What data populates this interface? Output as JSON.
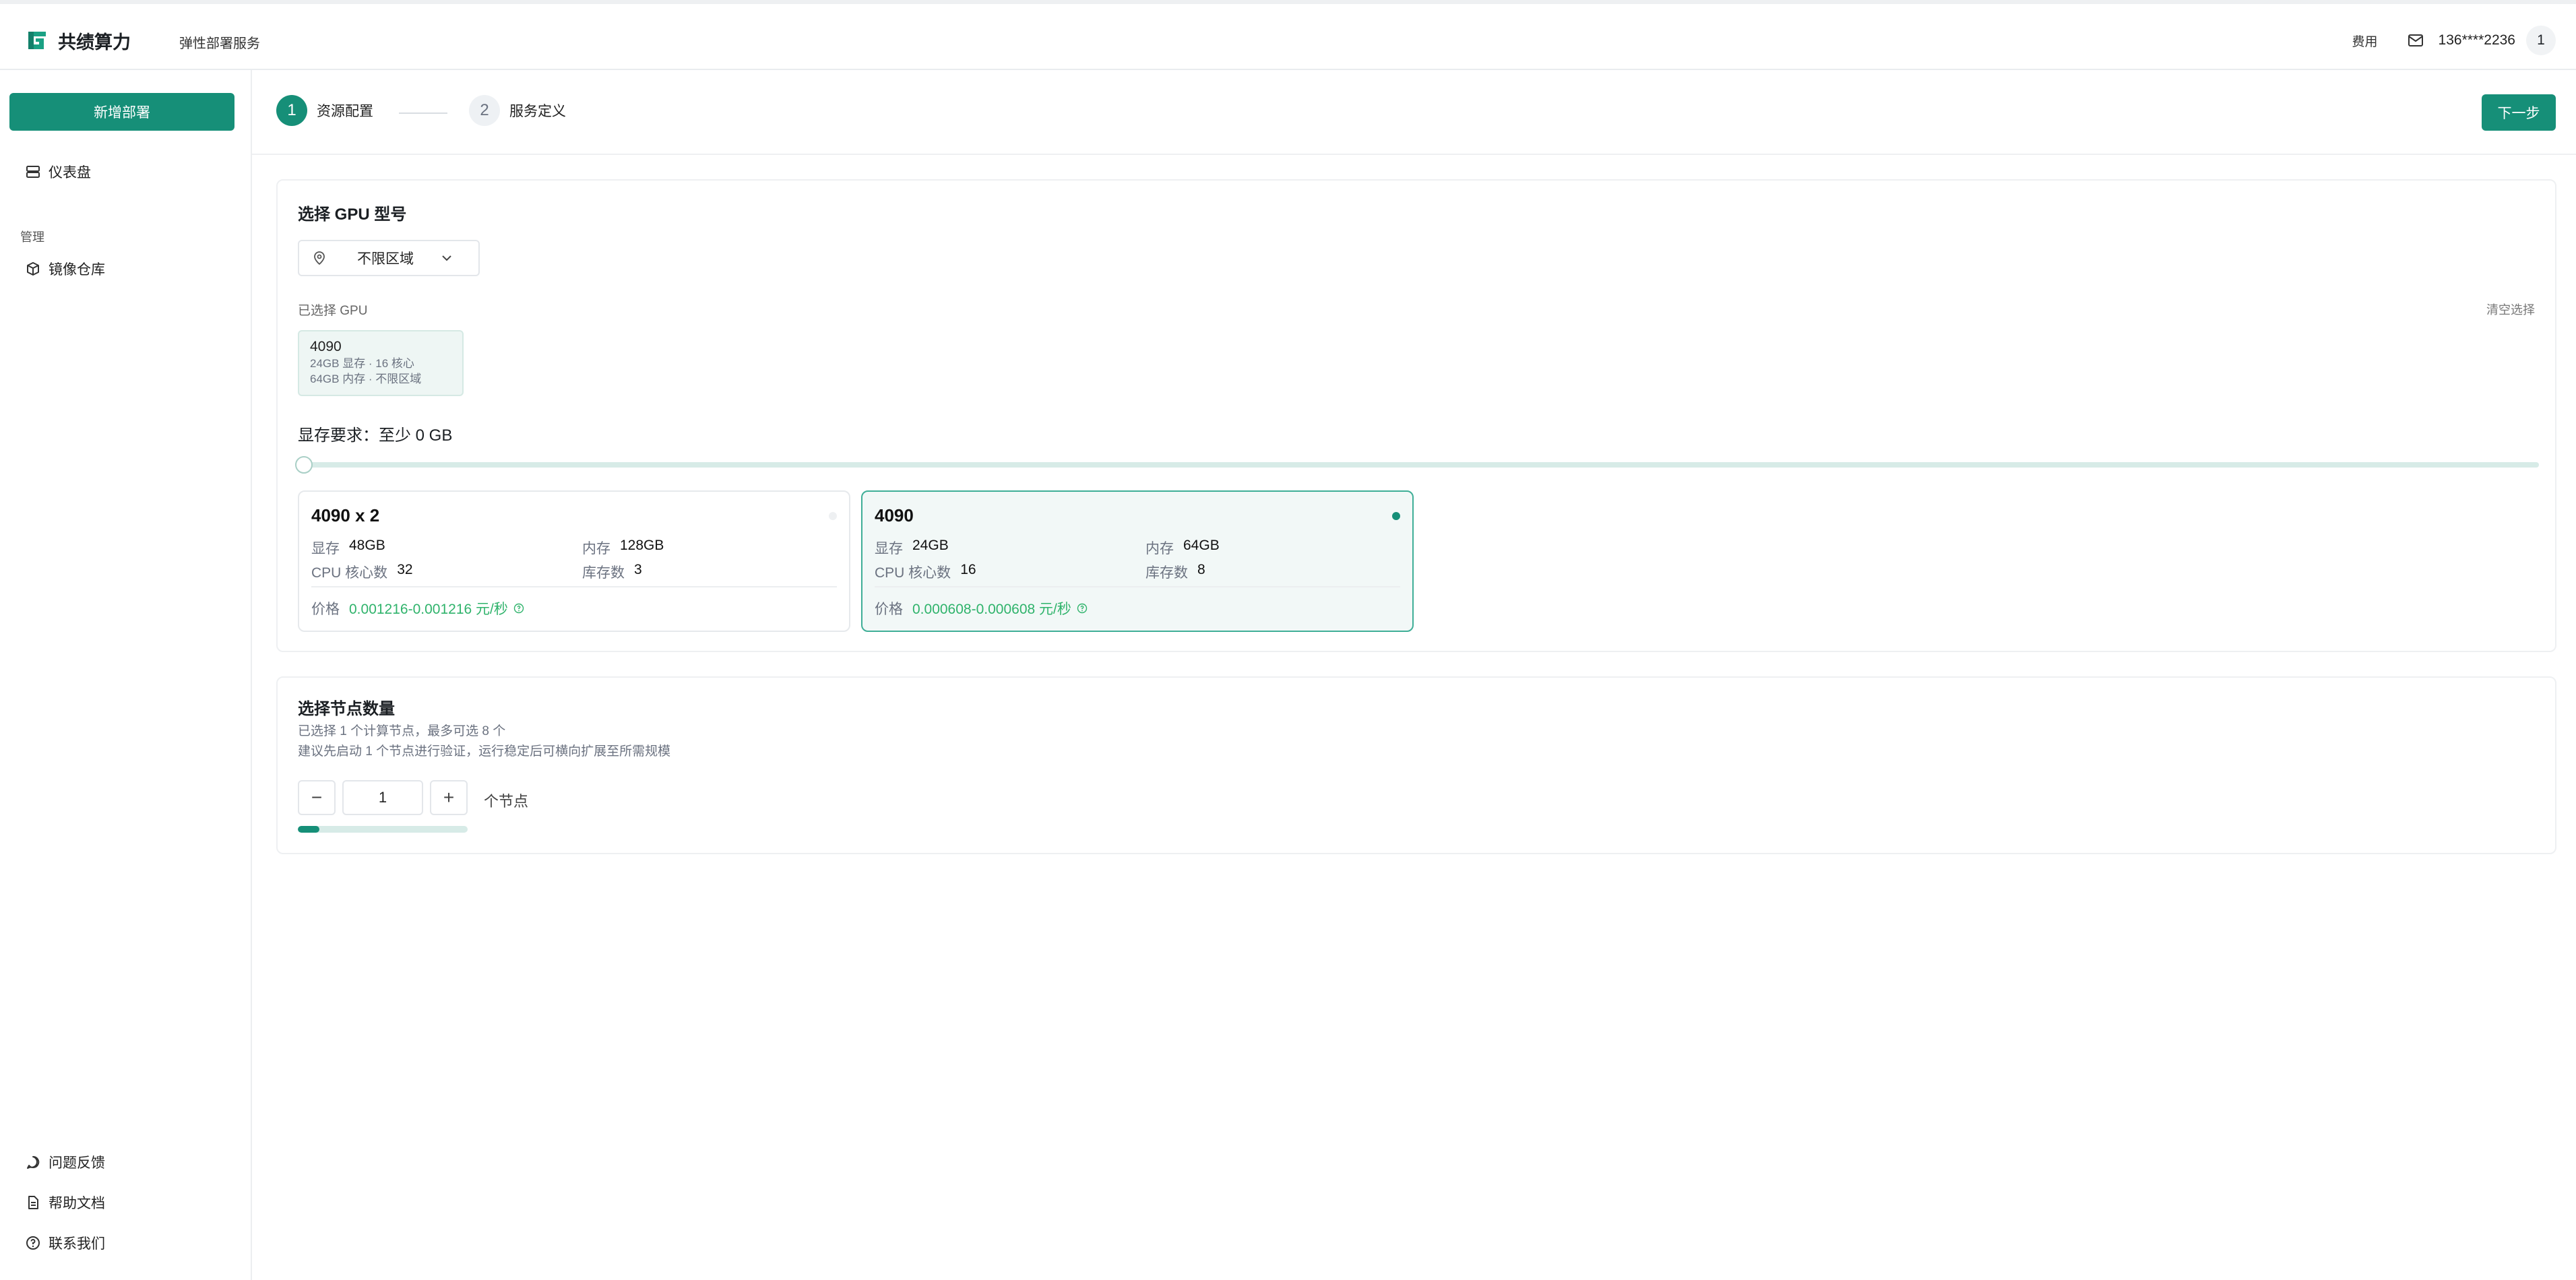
{
  "app": {
    "brand": "共绩算力",
    "product": "弹性部署服务"
  },
  "header": {
    "fee_label": "费用",
    "phone": "136****2236",
    "badge": "1"
  },
  "sidebar": {
    "new_deploy": "新增部署",
    "items": [
      {
        "label": "仪表盘",
        "icon": "dashboard-icon"
      },
      {
        "label": "镜像仓库",
        "icon": "box-icon"
      }
    ],
    "section_label": "管理",
    "bottom_items": [
      {
        "label": "问题反馈",
        "icon": "chat-icon"
      },
      {
        "label": "帮助文档",
        "icon": "document-icon"
      },
      {
        "label": "联系我们",
        "icon": "help-icon"
      }
    ]
  },
  "steps": [
    {
      "num": "1",
      "label": "资源配置",
      "active": true
    },
    {
      "num": "2",
      "label": "服务定义",
      "active": false
    }
  ],
  "next_button": "下一步",
  "gpu_panel": {
    "title": "选择 GPU 型号",
    "region": "不限区域",
    "selected_label": "已选择 GPU",
    "clear_label": "清空选择",
    "chip": {
      "name": "4090",
      "line1": "24GB 显存 · 16 核心",
      "line2": "64GB 内存 · 不限区域"
    },
    "memory_requirement": "显存要求：至少 0 GB",
    "slider_value": 0,
    "cards": [
      {
        "name": "4090 x 2",
        "vram_k": "显存",
        "vram": "48GB",
        "mem_k": "内存",
        "mem": "128GB",
        "cpu_k": "CPU 核心数",
        "cpu": "32",
        "stock_k": "库存数",
        "stock": "3",
        "price_k": "价格",
        "price": "0.001216-0.001216 元/秒",
        "selected": false
      },
      {
        "name": "4090",
        "vram_k": "显存",
        "vram": "24GB",
        "mem_k": "内存",
        "mem": "64GB",
        "cpu_k": "CPU 核心数",
        "cpu": "16",
        "stock_k": "库存数",
        "stock": "8",
        "price_k": "价格",
        "price": "0.000608-0.000608 元/秒",
        "selected": true
      }
    ]
  },
  "node_panel": {
    "title": "选择节点数量",
    "desc1": "已选择 1 个计算节点，最多可选 8 个",
    "desc2": "建议先启动 1 个节点进行验证，运行稳定后可横向扩展至所需规模",
    "minus": "−",
    "plus": "+",
    "quantity": "1",
    "unit": "个节点",
    "progress": 0.125
  },
  "colors": {
    "accent": "#168f78",
    "price": "#2fb36b"
  }
}
